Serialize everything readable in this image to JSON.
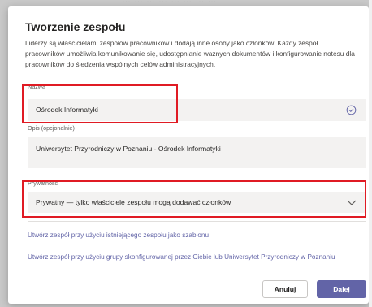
{
  "backdrop": {
    "text": "… … … … … … … …"
  },
  "dialog": {
    "title": "Tworzenie zespołu",
    "description": "Liderzy są właścicielami zespołów pracowników i dodają inne osoby jako członków. Każdy zespół pracowników umożliwia komunikowanie się, udostępnianie ważnych dokumentów i konfigurowanie notesu dla pracowników do śledzenia wspólnych celów administracyjnych.",
    "name": {
      "label": "Nazwa",
      "value": "Ośrodek Informatyki",
      "status_icon": "check-circle-icon"
    },
    "description_field": {
      "label": "Opis (opcjonalnie)",
      "value": "Uniwersytet Przyrodniczy w Poznaniu - Ośrodek Informatyki"
    },
    "privacy": {
      "label": "Prywatność",
      "value": "Prywatny — tylko właściciele zespołu mogą dodawać członków",
      "icon": "chevron-down-icon"
    },
    "links": {
      "from_team": "Utwórz zespół przy użyciu istniejącego zespołu jako szablonu",
      "from_group": "Utwórz zespół przy użyciu grupy skonfigurowanej przez Ciebie lub Uniwersytet Przyrodniczy w Poznaniu"
    },
    "buttons": {
      "cancel": "Anuluj",
      "next": "Dalej"
    }
  },
  "colors": {
    "accent": "#6264a7",
    "highlight": "#e01b24",
    "field_bg": "#f3f2f1",
    "backdrop": "#c9c9c9"
  }
}
